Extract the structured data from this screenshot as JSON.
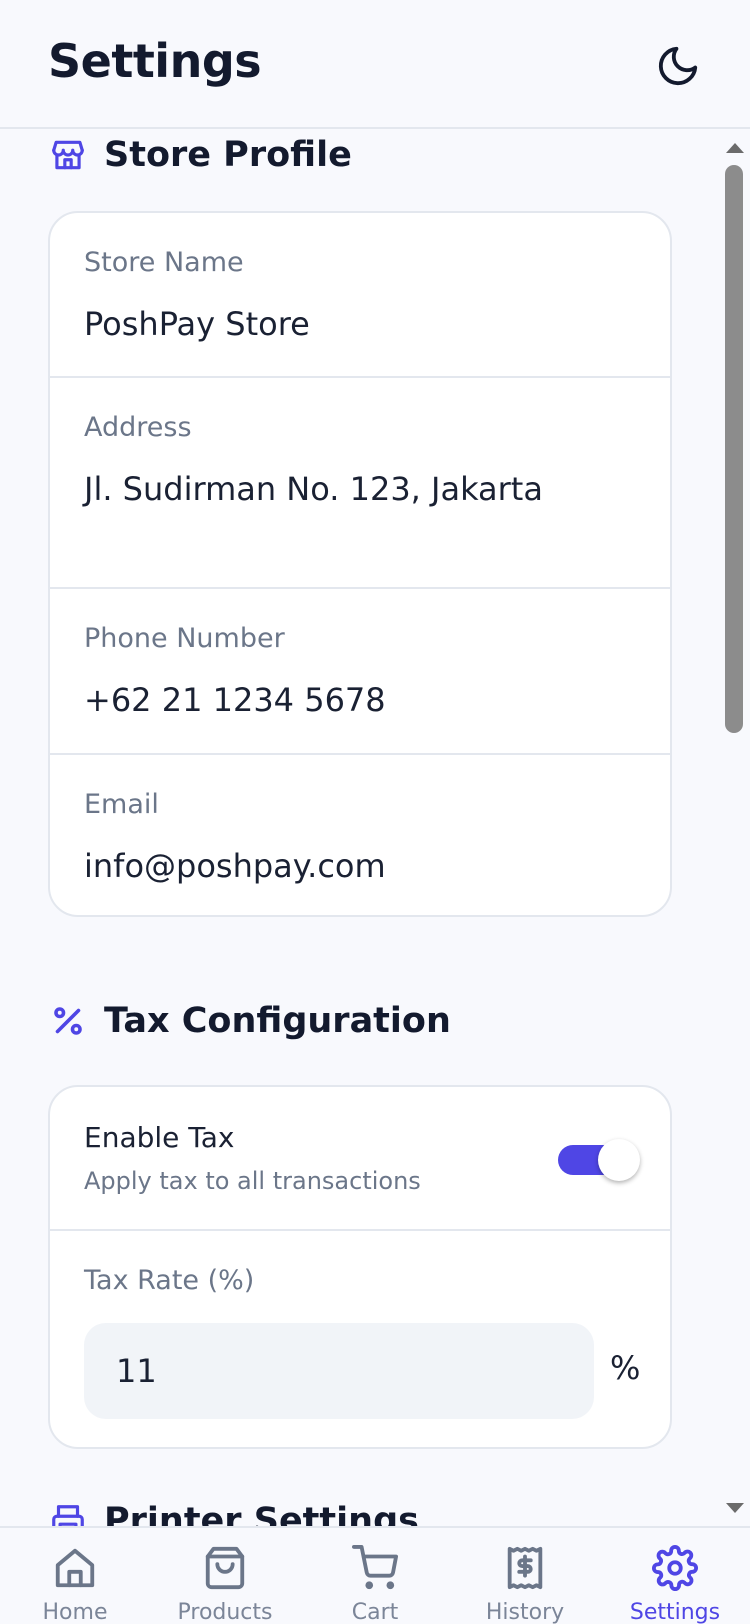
{
  "header": {
    "title": "Settings",
    "theme_toggle_icon": "moon-icon"
  },
  "store_profile": {
    "title": "Store Profile",
    "icon": "store-icon",
    "fields": [
      {
        "label": "Store Name",
        "value": "PoshPay Store"
      },
      {
        "label": "Address",
        "value": "Jl. Sudirman No. 123, Jakarta"
      },
      {
        "label": "Phone Number",
        "value": "+62 21 1234 5678"
      },
      {
        "label": "Email",
        "value": "info@poshpay.com"
      }
    ]
  },
  "tax_configuration": {
    "title": "Tax Configuration",
    "icon": "percent-icon",
    "enable_tax": {
      "title": "Enable Tax",
      "subtitle": "Apply tax to all transactions",
      "enabled": true
    },
    "tax_rate": {
      "label": "Tax Rate (%)",
      "value": "11",
      "suffix": "%"
    }
  },
  "printer_settings": {
    "title": "Printer Settings",
    "icon": "printer-icon"
  },
  "bottom_nav": {
    "items": [
      {
        "label": "Home",
        "icon": "home-icon",
        "active": false
      },
      {
        "label": "Products",
        "icon": "shopping-bag-icon",
        "active": false
      },
      {
        "label": "Cart",
        "icon": "cart-icon",
        "active": false
      },
      {
        "label": "History",
        "icon": "receipt-icon",
        "active": false
      },
      {
        "label": "Settings",
        "icon": "gear-icon",
        "active": true
      }
    ]
  },
  "colors": {
    "accent": "#4f46e5",
    "text_primary": "#131a2e",
    "text_muted": "#6b7689",
    "background": "#f8f9fd",
    "card": "#ffffff",
    "border": "#e3e7ee"
  }
}
